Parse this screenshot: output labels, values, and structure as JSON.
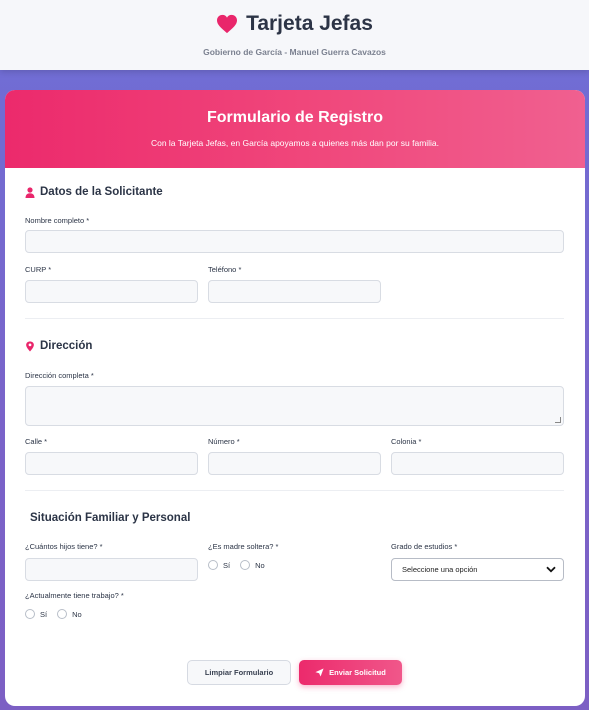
{
  "header": {
    "title": "Tarjeta Jefas",
    "subtitle": "Gobierno de García - Manuel Guerra Cavazos",
    "icon": "heart-icon",
    "icon_color": "#e9266b"
  },
  "form": {
    "title": "Formulario de Registro",
    "description": "Con la Tarjeta Jefas, en García apoyamos a quienes más dan por su familia.",
    "accent": "#ec2a6c",
    "sections": {
      "applicant": {
        "title": "Datos de la Solicitante",
        "icon": "user-icon",
        "full_name_label": "Nombre completo *",
        "curp_label": "CURP *",
        "phone_label": "Teléfono *"
      },
      "address": {
        "title": "Dirección",
        "icon": "map-pin-icon",
        "full_address_label": "Dirección completa *",
        "street_label": "Calle *",
        "number_label": "Número *",
        "neighborhood_label": "Colonia *"
      },
      "family": {
        "title": "Situación Familiar y Personal",
        "children_label": "¿Cuántos hijos tiene? *",
        "single_mother_label": "¿Es madre soltera? *",
        "single_mother_yes": "Sí",
        "single_mother_no": "No",
        "education_label": "Grado de estudios *",
        "education_selected": "Seleccione una opción",
        "working_label": "¿Actualmente tiene trabajo? *",
        "working_yes": "Sí",
        "working_no": "No"
      }
    },
    "buttons": {
      "clear": "Limpiar Formulario",
      "submit": "Enviar Solicitud"
    }
  }
}
